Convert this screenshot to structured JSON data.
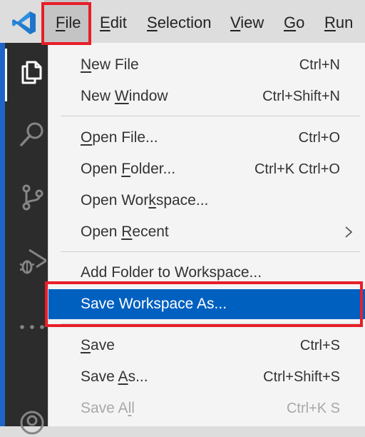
{
  "menubar": {
    "items": [
      {
        "label": "File",
        "ul": 0
      },
      {
        "label": "Edit",
        "ul": 0
      },
      {
        "label": "Selection",
        "ul": 0
      },
      {
        "label": "View",
        "ul": 0
      },
      {
        "label": "Go",
        "ul": 0
      },
      {
        "label": "Run",
        "ul": 0
      }
    ]
  },
  "activity_bar": {
    "icons": [
      "explorer-icon",
      "search-icon",
      "source-control-icon",
      "run-debug-icon",
      "more-icon",
      "accounts-icon"
    ]
  },
  "file_menu": {
    "items": [
      {
        "label": "New File",
        "ul": 0,
        "shortcut": "Ctrl+N"
      },
      {
        "label": "New Window",
        "ul": 4,
        "shortcut": "Ctrl+Shift+N"
      },
      {
        "label": "Open File...",
        "ul": 0,
        "shortcut": "Ctrl+O"
      },
      {
        "label": "Open Folder...",
        "ul": 5,
        "shortcut": "Ctrl+K Ctrl+O"
      },
      {
        "label": "Open Workspace...",
        "ul": 8,
        "shortcut": ""
      },
      {
        "label": "Open Recent",
        "ul": 5,
        "shortcut": "",
        "submenu": true
      },
      {
        "label": "Add Folder to Workspace...",
        "ul": -1,
        "shortcut": ""
      },
      {
        "label": "Save Workspace As...",
        "ul": -1,
        "shortcut": "",
        "highlighted": true
      },
      {
        "label": "Save",
        "ul": 0,
        "shortcut": "Ctrl+S"
      },
      {
        "label": "Save As...",
        "ul": 5,
        "shortcut": "Ctrl+Shift+S"
      },
      {
        "label": "Save All",
        "ul": 6,
        "shortcut": "Ctrl+K S",
        "disabled": true
      }
    ]
  },
  "colors": {
    "highlight": "#0060c0",
    "annotation_red": "#e81e28",
    "activity_bar": "#2c2c2c",
    "menubar": "#dddddd"
  }
}
